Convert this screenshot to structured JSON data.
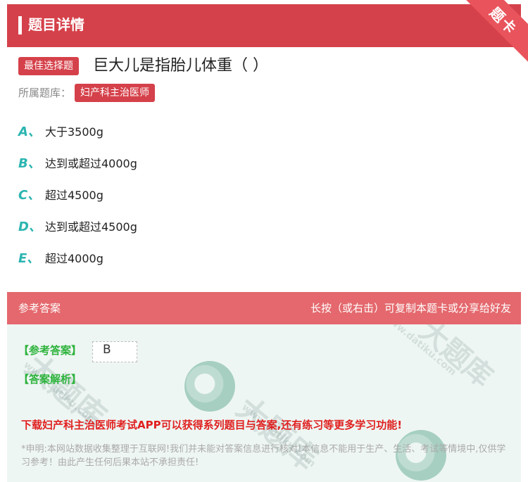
{
  "header": {
    "title": "题目详情",
    "ribbon": "题卡"
  },
  "question": {
    "type_tag": "最佳选择题",
    "text": "巨大儿是指胎儿体重（  ）",
    "library_label": "所属题库：",
    "library_tag": "妇产科主治医师"
  },
  "options": [
    {
      "letter": "A、",
      "text": "大于3500g"
    },
    {
      "letter": "B、",
      "text": "达到或超过4000g"
    },
    {
      "letter": "C、",
      "text": "超过4500g"
    },
    {
      "letter": "D、",
      "text": "达到或超过4500g"
    },
    {
      "letter": "E、",
      "text": "超过4000g"
    }
  ],
  "answer_section": {
    "title": "参考答案",
    "hint": "长按（或右击）可复制本题卡或分享给好友",
    "answer_label": "【参考答案】",
    "answer_value": "B",
    "analysis_label": "【答案解析】",
    "promo": "下载妇产科主治医师考试APP可以获得系列题目与答案,还有练习等更多学习功能!",
    "disclaimer": "*申明:本网站数据收集整理于互联网!我们并未能对答案信息进行核对!本信息不能用于生产、生活、考试等情境中,仅供学习参考！由此产生任何后果本站不承担责任!"
  },
  "watermark": {
    "brand": "大题库",
    "site": "www.datiku.com"
  },
  "colors": {
    "primary": "#d5414a",
    "answer_header": "#e4686d",
    "option_letter": "#2bb5b0",
    "answer_label": "#2db33c",
    "promo": "#e02020"
  }
}
